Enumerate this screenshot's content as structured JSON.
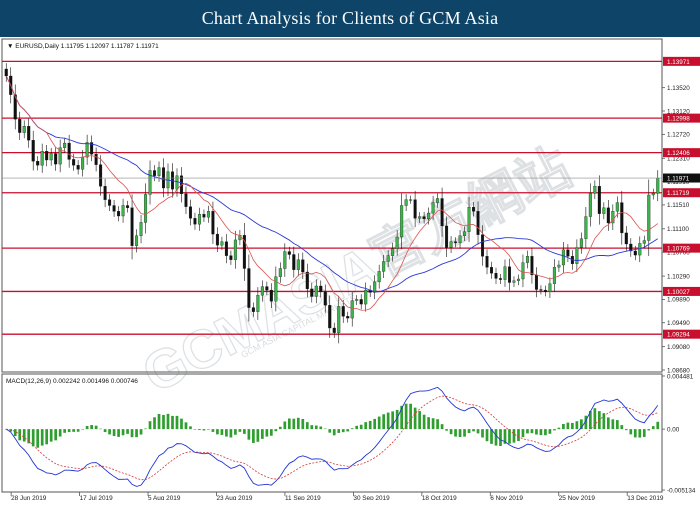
{
  "banner": {
    "title": "Chart Analysis for Clients of GCM Asia"
  },
  "watermark": {
    "text": "GCMASIA官方網站",
    "subtext": "GCM ASIA CAPITAL MARKETS"
  },
  "colors": {
    "banner_bg": "#0e4468",
    "bull_candle": "#3cb44b",
    "bear_candle": "#111111",
    "level_line": "#c8102e",
    "ma_fast": "#d9534f",
    "ma_slow": "#2b3bd6",
    "macd_line": "#2236d6",
    "signal_line": "#d23a3a",
    "histogram": "#2e9e2e",
    "current_price_tag": "#111111"
  },
  "chart_data": [
    {
      "type": "candlestick",
      "header": {
        "symbol": "EURUSD,Daily",
        "open": "1.11795",
        "high": "1.12097",
        "low": "1.11787",
        "close": "1.11971"
      },
      "ylim": [
        1.0868,
        1.1432
      ],
      "y_ticks": [
        "1.13520",
        "1.13120",
        "1.12720",
        "1.12310",
        "1.11910",
        "1.11510",
        "1.11100",
        "1.10700",
        "1.10290",
        "1.09890",
        "1.09490",
        "1.09080",
        "1.08680"
      ],
      "x_ticks": [
        "28 Jun 2019",
        "17 Jul 2019",
        "5 Aug 2019",
        "23 Aug 2019",
        "11 Sep 2019",
        "30 Sep 2019",
        "18 Oct 2019",
        "6 Nov 2019",
        "25 Nov 2019",
        "13 Dec 2019"
      ],
      "levels": [
        {
          "value": 1.13971,
          "label": "1.13971"
        },
        {
          "value": 1.12998,
          "label": "1.12998"
        },
        {
          "value": 1.12406,
          "label": "1.12406"
        },
        {
          "value": 1.11719,
          "label": "1.11719"
        },
        {
          "value": 1.10769,
          "label": "1.10769"
        },
        {
          "value": 1.10027,
          "label": "1.10027"
        },
        {
          "value": 1.09294,
          "label": "1.09294"
        }
      ],
      "current_price": {
        "value": 1.11971,
        "label": "1.11971"
      },
      "close_series": [
        1.1372,
        1.134,
        1.1298,
        1.1275,
        1.1286,
        1.1262,
        1.1226,
        1.1219,
        1.1243,
        1.1228,
        1.1239,
        1.1221,
        1.1249,
        1.1257,
        1.1229,
        1.1219,
        1.1212,
        1.1233,
        1.1258,
        1.1238,
        1.122,
        1.1183,
        1.116,
        1.115,
        1.114,
        1.1132,
        1.115,
        1.1146,
        1.1081,
        1.1098,
        1.1121,
        1.1169,
        1.121,
        1.1201,
        1.1215,
        1.118,
        1.1208,
        1.1178,
        1.1201,
        1.117,
        1.1148,
        1.1128,
        1.1118,
        1.1135,
        1.113,
        1.114,
        1.1101,
        1.1082,
        1.1088,
        1.1064,
        1.1057,
        1.1091,
        1.1099,
        1.1042,
        1.0975,
        1.0968,
        1.0996,
        1.1011,
        1.1005,
        1.0986,
        1.1028,
        1.1042,
        1.1071,
        1.1066,
        1.104,
        1.1057,
        1.1036,
        1.1007,
        1.0994,
        1.1012,
        1.1002,
        1.0979,
        1.094,
        1.0932,
        1.0977,
        1.096,
        1.0957,
        1.0987,
        1.0989,
        1.0981,
        1.1005,
        1.1001,
        1.1019,
        1.1037,
        1.1054,
        1.1064,
        1.1076,
        1.1096,
        1.115,
        1.116,
        1.116,
        1.1128,
        1.1131,
        1.1127,
        1.1137,
        1.1155,
        1.1162,
        1.1115,
        1.1078,
        1.1088,
        1.1086,
        1.1098,
        1.1105,
        1.1147,
        1.114,
        1.11,
        1.1063,
        1.1044,
        1.1034,
        1.1025,
        1.1023,
        1.1045,
        1.1018,
        1.1021,
        1.1024,
        1.1052,
        1.1063,
        1.1031,
        1.1006,
        1.1005,
        1.1002,
        1.1016,
        1.1044,
        1.1048,
        1.1074,
        1.1063,
        1.105,
        1.1078,
        1.1093,
        1.1131,
        1.1171,
        1.1183,
        1.1136,
        1.1146,
        1.112,
        1.114,
        1.1155,
        1.1103,
        1.1084,
        1.1072,
        1.1065,
        1.1085,
        1.109,
        1.1168,
        1.1171,
        1.1197
      ],
      "ma_fast_label": "",
      "ma_slow_label": ""
    },
    {
      "type": "macd",
      "label": "MACD(12,26,9) 0.002242 0.001496 0.000746",
      "ylim": [
        -0.005134,
        0.004481
      ],
      "y_ticks": [
        "0.004481",
        "0.00",
        "-0.005134"
      ]
    }
  ]
}
